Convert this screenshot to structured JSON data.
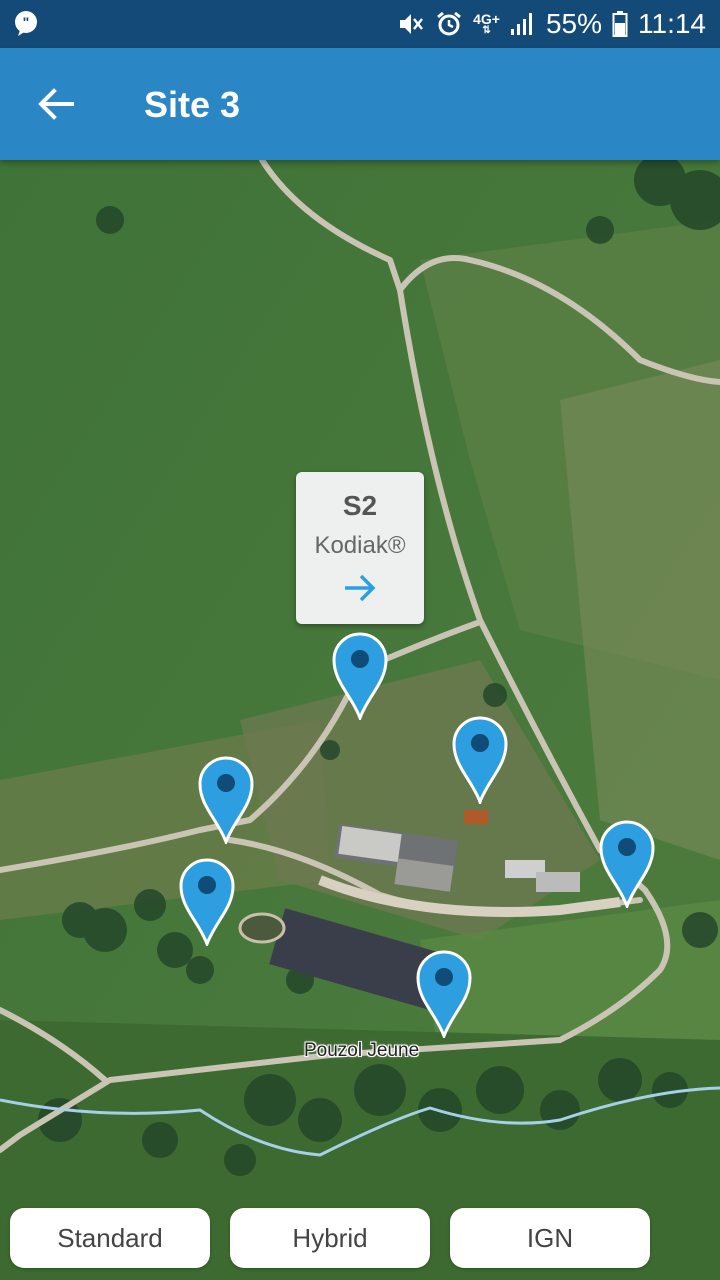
{
  "status_bar": {
    "network": "4G+",
    "battery": "55%",
    "time": "11:14",
    "icons": [
      "chat-bubble-icon",
      "mute-icon",
      "alarm-icon",
      "signal-icon",
      "battery-icon"
    ]
  },
  "app_bar": {
    "title": "Site 3",
    "back_icon": "arrow-left-icon"
  },
  "map": {
    "callout": {
      "title": "S2",
      "subtitle": "Kodiak®",
      "icon": "arrow-right-icon"
    },
    "place_label": "Pouzol Jeune",
    "marker_color": "#2d9ee0",
    "marker_count": 6
  },
  "map_types": [
    "Standard",
    "Hybrid",
    "IGN"
  ],
  "colors": {
    "status_bar": "#144a78",
    "app_bar": "#2a86c4",
    "accent": "#2d9ee0"
  }
}
